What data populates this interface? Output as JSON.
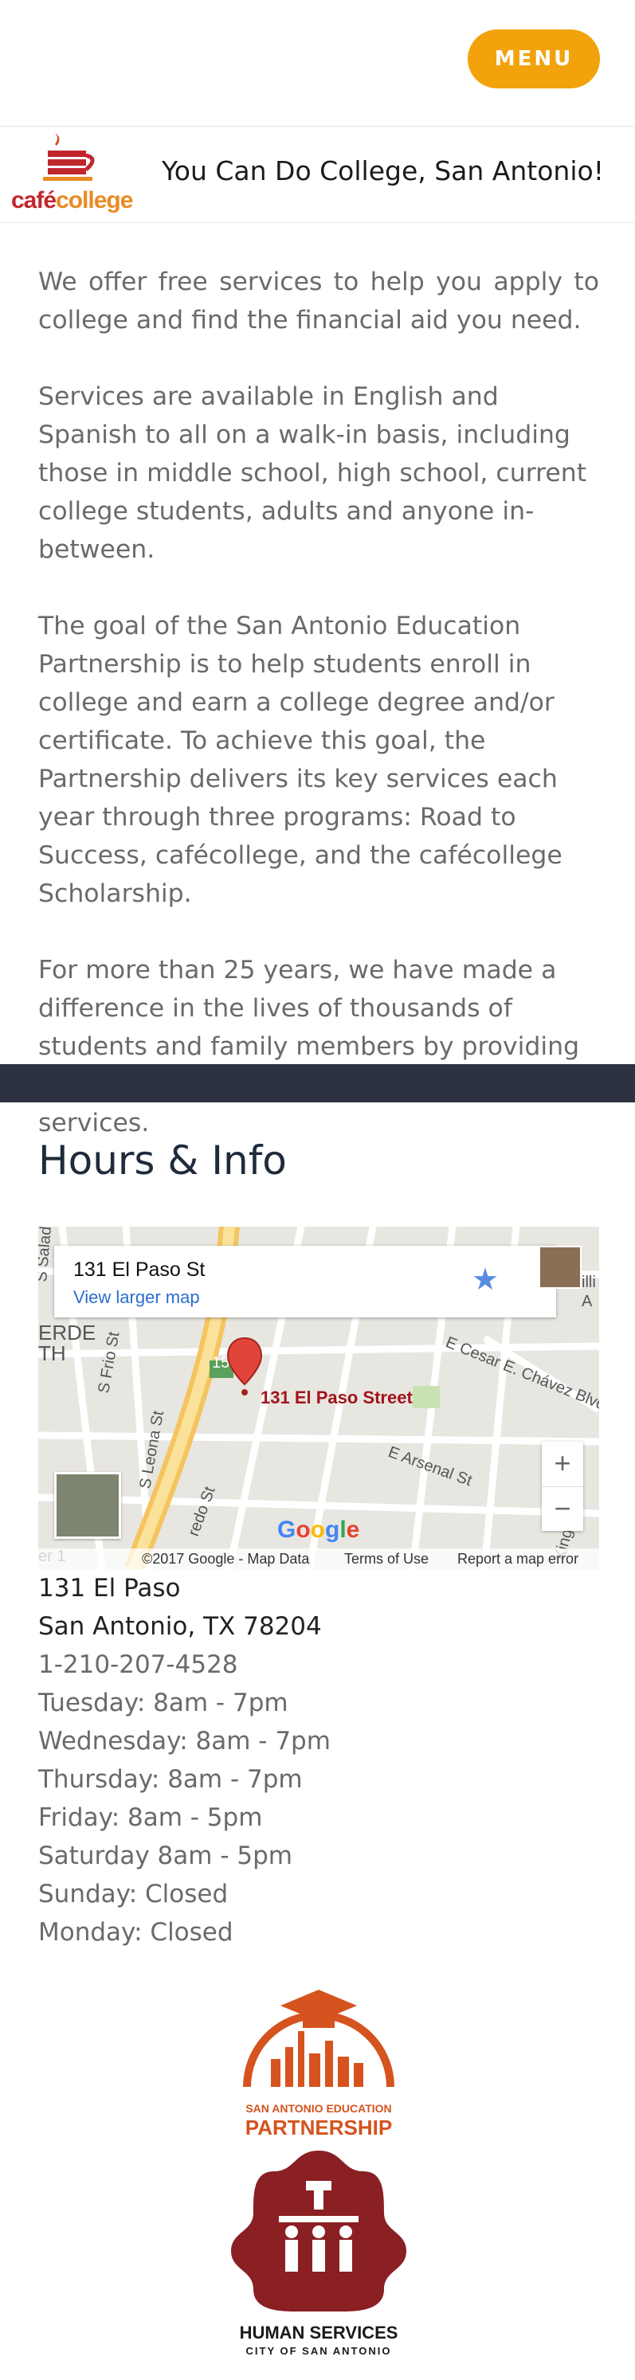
{
  "nav": {
    "menu_label": "MENU"
  },
  "brand": {
    "logo_text_1": "café",
    "logo_text_2": "college",
    "tagline": "You Can Do College, San Antonio!"
  },
  "intro": {
    "paragraphs": [
      "We offer free services to help you apply to college and find the financial aid you need.",
      "Services are available in English and Spanish to all on a walk-in basis, including those in middle school, high school, current college students, adults and anyone in-between.",
      "The goal of the San Antonio Education Partnership is to help students enroll in college and earn a college degree and/or certificate. To achieve this goal, the Partnership delivers its key services each year through three programs: Road to Success, cafécollege, and the cafécollege Scholarship.",
      "For more than 25 years, we have made a difference in the lives of thousands of students and family members by providing millions of dollars in scholarships and services."
    ]
  },
  "hours": {
    "title": "Hours & Info",
    "address_line1": "131 El Paso",
    "address_line2": "San Antonio, TX 78204",
    "phone": "1-210-207-4528",
    "schedule": [
      "Tuesday: 8am - 7pm",
      "Wednesday: 8am - 7pm",
      "Thursday: 8am - 7pm",
      "Friday: 8am - 5pm",
      "Saturday 8am - 5pm",
      "Sunday: Closed",
      "Monday: Closed"
    ]
  },
  "map": {
    "place_title": "131 El Paso St",
    "larger_map_link": "View larger map",
    "pin_label": "131 El Paso Street",
    "zoom_in": "+",
    "zoom_out": "−",
    "copyright": "©2017 Google - Map Data",
    "terms": "Terms of Use",
    "report": "Report a map error",
    "google_logo": "Google",
    "street_labels": [
      "S Frio St",
      "S Leona St",
      "E Cesar E. Chávez Blvd",
      "E Arsenal St",
      "redo St",
      "S Salado",
      "ERDE",
      "TH",
      "15",
      "er 1",
      "King",
      "illi",
      "A"
    ]
  },
  "partners": {
    "sa_ed_line1": "SAN ANTONIO EDUCATION",
    "sa_ed_line2": "PARTNERSHIP",
    "hs_line1": "HUMAN SERVICES",
    "hs_line2": "CITY OF SAN ANTONIO"
  },
  "colors": {
    "menu_button": "#f2a20a",
    "dark_band": "#2c3241",
    "partner_orange": "#d5531f",
    "partner_maroon": "#8a1f24"
  }
}
